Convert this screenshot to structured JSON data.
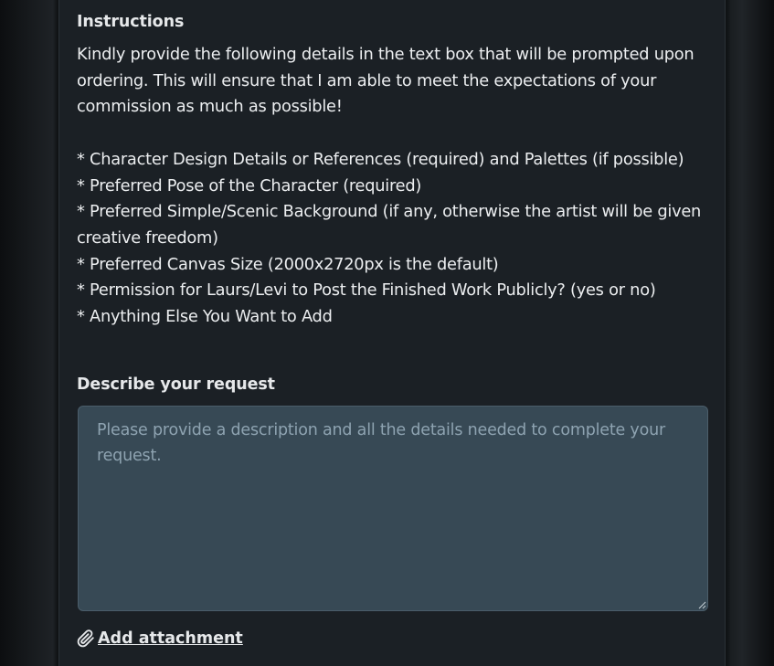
{
  "instructions": {
    "title": "Instructions",
    "paragraph": "Kindly provide the following details in the text box that will be prompted upon ordering. This will ensure that I am able to meet the expectations of your commission as much as possible!",
    "items": [
      "* Character Design Details or References (required) and Palettes (if possible)",
      "* Preferred Pose of the Character (required)",
      "* Preferred Simple/Scenic Background (if any, otherwise the artist will be given creative freedom)",
      "* Preferred Canvas Size (2000x2720px is the default)",
      "* Permission for Laurs/Levi to Post the Finished Work Publicly? (yes or no)",
      "* Anything Else You Want to Add"
    ]
  },
  "request": {
    "label": "Describe your request",
    "value": "",
    "placeholder": "Please provide a description and all the details needed to complete your request."
  },
  "attachment": {
    "label": "Add attachment",
    "icon": "paperclip-icon"
  },
  "colors": {
    "panel_background": "#1b2025",
    "text": "#eceef0",
    "textarea_background": "#374955",
    "placeholder": "#8ea3b1"
  }
}
